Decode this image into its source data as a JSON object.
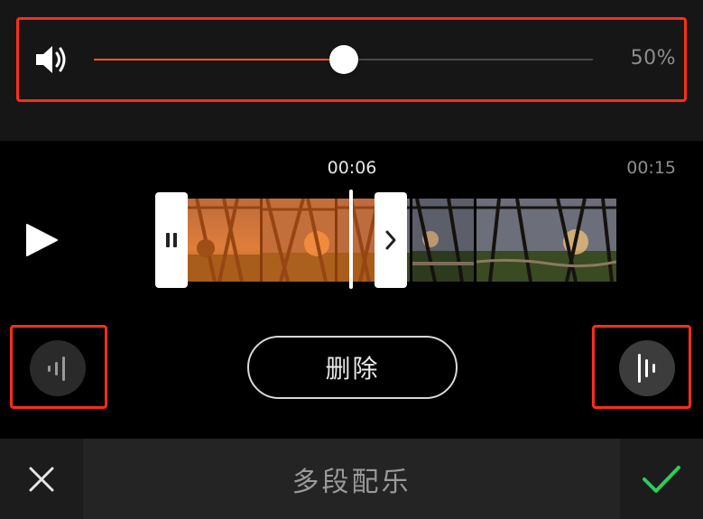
{
  "volume": {
    "icon": "speaker-icon",
    "level": 0.5,
    "percent_label": "50%",
    "fill_color": "#ff5a1f"
  },
  "timeline": {
    "current_time": "00:06",
    "total_time": "00:15",
    "selection_color": "#ff6e14"
  },
  "controls": {
    "play_icon": "play-icon",
    "fade_in_icon": "fade-in-waveform-icon",
    "fade_out_icon": "fade-out-waveform-icon",
    "delete_label": "删除"
  },
  "footer": {
    "title": "多段配乐",
    "cancel_icon": "close-icon",
    "confirm_icon": "checkmark-icon",
    "confirm_color": "#2ecc5a"
  },
  "highlight_color": "#ff2d1a"
}
